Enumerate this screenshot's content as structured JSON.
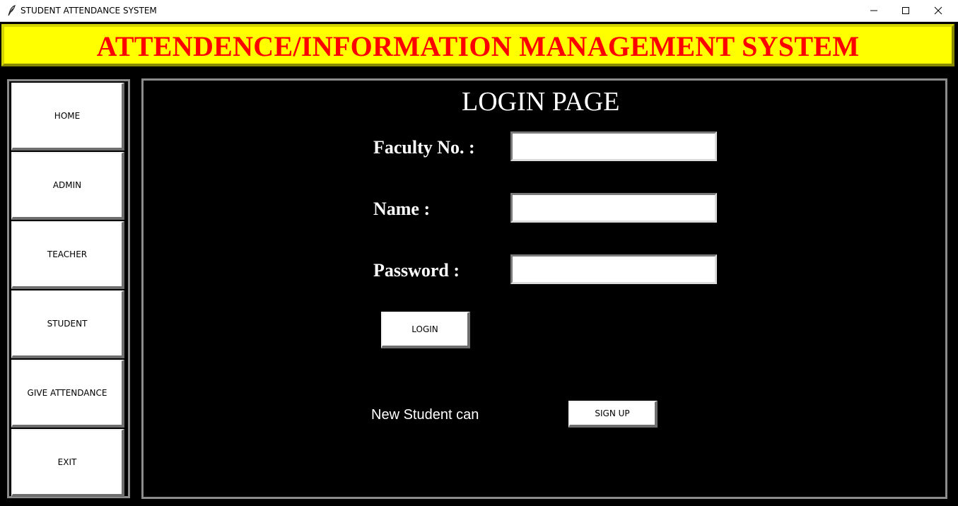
{
  "window": {
    "title": "STUDENT ATTENDANCE SYSTEM",
    "icon": "feather-icon",
    "controls": [
      "minimize-icon",
      "maximize-icon",
      "close-icon"
    ]
  },
  "header": {
    "title": "ATTENDENCE/INFORMATION MANAGEMENT SYSTEM",
    "text_color": "#ff0000",
    "background_color": "#ffff00"
  },
  "sidebar": {
    "items": [
      {
        "label": "HOME"
      },
      {
        "label": "ADMIN"
      },
      {
        "label": "TEACHER"
      },
      {
        "label": "STUDENT"
      },
      {
        "label": "GIVE ATTENDANCE"
      },
      {
        "label": "EXIT"
      }
    ]
  },
  "login": {
    "title": "LOGIN PAGE",
    "fields": [
      {
        "label": "Faculty No. :",
        "value": "",
        "placeholder": ""
      },
      {
        "label": "Name :",
        "value": "",
        "placeholder": ""
      },
      {
        "label": "Password :",
        "value": "",
        "placeholder": ""
      }
    ],
    "login_button": "LOGIN",
    "new_student_text": "New Student can",
    "signup_button": "SIGN UP"
  }
}
